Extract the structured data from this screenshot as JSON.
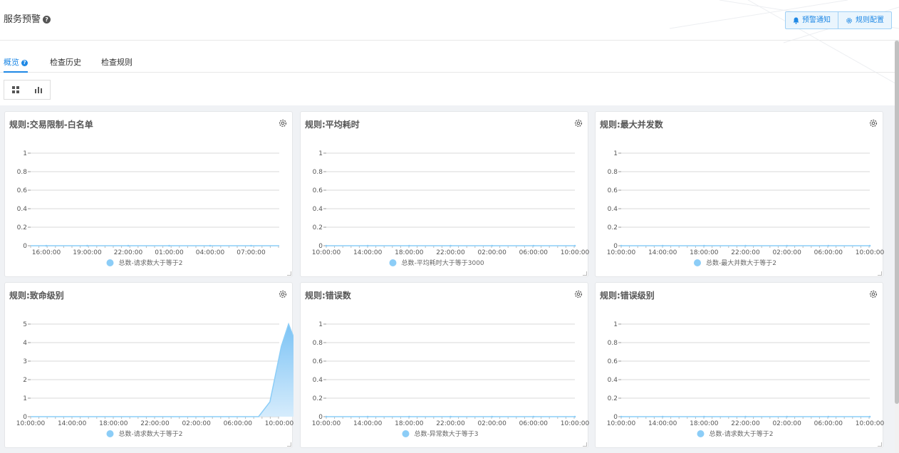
{
  "header": {
    "title": "服务预警",
    "help_glyph": "?",
    "alert_notify_label": "预警通知",
    "rule_config_label": "规则配置"
  },
  "tabs": [
    {
      "label": "概览",
      "active": true
    },
    {
      "label": "检查历史",
      "active": false
    },
    {
      "label": "检查规则",
      "active": false
    }
  ],
  "colors": {
    "accent": "#1e88e5",
    "series": "#8ccdf7"
  },
  "chart_data": [
    {
      "type": "line",
      "title": "规则:交易限制-白名单",
      "x": [
        "16:00:00",
        "19:00:00",
        "22:00:00",
        "01:00:00",
        "04:00:00",
        "07:00:00"
      ],
      "ylim": [
        0,
        1
      ],
      "yticks": [
        "0",
        "0.2",
        "0.4",
        "0.6",
        "0.8",
        "1"
      ],
      "series": [
        {
          "name": "总数-请求数大于等于2",
          "values": [
            0,
            0,
            0,
            0,
            0,
            0
          ]
        }
      ]
    },
    {
      "type": "line",
      "title": "规则:平均耗时",
      "x": [
        "10:00:00",
        "14:00:00",
        "18:00:00",
        "22:00:00",
        "02:00:00",
        "06:00:00",
        "10:00:00"
      ],
      "ylim": [
        0,
        1
      ],
      "yticks": [
        "0",
        "0.2",
        "0.4",
        "0.6",
        "0.8",
        "1"
      ],
      "series": [
        {
          "name": "总数-平均耗时大于等于3000",
          "values": [
            0,
            0,
            0,
            0,
            0,
            0,
            0
          ]
        }
      ]
    },
    {
      "type": "line",
      "title": "规则:最大并发数",
      "x": [
        "10:00:00",
        "14:00:00",
        "18:00:00",
        "22:00:00",
        "02:00:00",
        "06:00:00",
        "10:00:00"
      ],
      "ylim": [
        0,
        1
      ],
      "yticks": [
        "0",
        "0.2",
        "0.4",
        "0.6",
        "0.8",
        "1"
      ],
      "series": [
        {
          "name": "总数-最大并数大于等于2",
          "values": [
            0,
            0,
            0,
            0,
            0,
            0,
            0
          ]
        }
      ]
    },
    {
      "type": "area",
      "title": "规则:致命级别",
      "x": [
        "10:00:00",
        "14:00:00",
        "18:00:00",
        "22:00:00",
        "02:00:00",
        "06:00:00",
        "10:00:00"
      ],
      "ylim": [
        0,
        5
      ],
      "yticks": [
        "0",
        "1",
        "2",
        "3",
        "4",
        "5"
      ],
      "series": [
        {
          "name": "总数-请求数大于等于2",
          "points": [
            [
              0,
              0
            ],
            [
              22,
              0
            ],
            [
              23.1,
              0.8
            ],
            [
              24.2,
              3.8
            ],
            [
              24.9,
              5
            ],
            [
              25.6,
              4
            ],
            [
              26.3,
              0.9
            ],
            [
              26.8,
              0
            ],
            [
              24,
              0
            ]
          ]
        }
      ]
    },
    {
      "type": "line",
      "title": "规则:错误数",
      "x": [
        "10:00:00",
        "14:00:00",
        "18:00:00",
        "22:00:00",
        "02:00:00",
        "06:00:00",
        "10:00:00"
      ],
      "ylim": [
        0,
        1
      ],
      "yticks": [
        "0",
        "0.2",
        "0.4",
        "0.6",
        "0.8",
        "1"
      ],
      "series": [
        {
          "name": "总数-异常数大于等于3",
          "values": [
            0,
            0,
            0,
            0,
            0,
            0,
            0
          ]
        }
      ]
    },
    {
      "type": "line",
      "title": "规则:错误级别",
      "x": [
        "10:00:00",
        "14:00:00",
        "18:00:00",
        "22:00:00",
        "02:00:00",
        "06:00:00",
        "10:00:00"
      ],
      "ylim": [
        0,
        1
      ],
      "yticks": [
        "0",
        "0.2",
        "0.4",
        "0.6",
        "0.8",
        "1"
      ],
      "series": [
        {
          "name": "总数-请求数大于等于2",
          "values": [
            0,
            0,
            0,
            0,
            0,
            0,
            0
          ]
        }
      ]
    }
  ]
}
